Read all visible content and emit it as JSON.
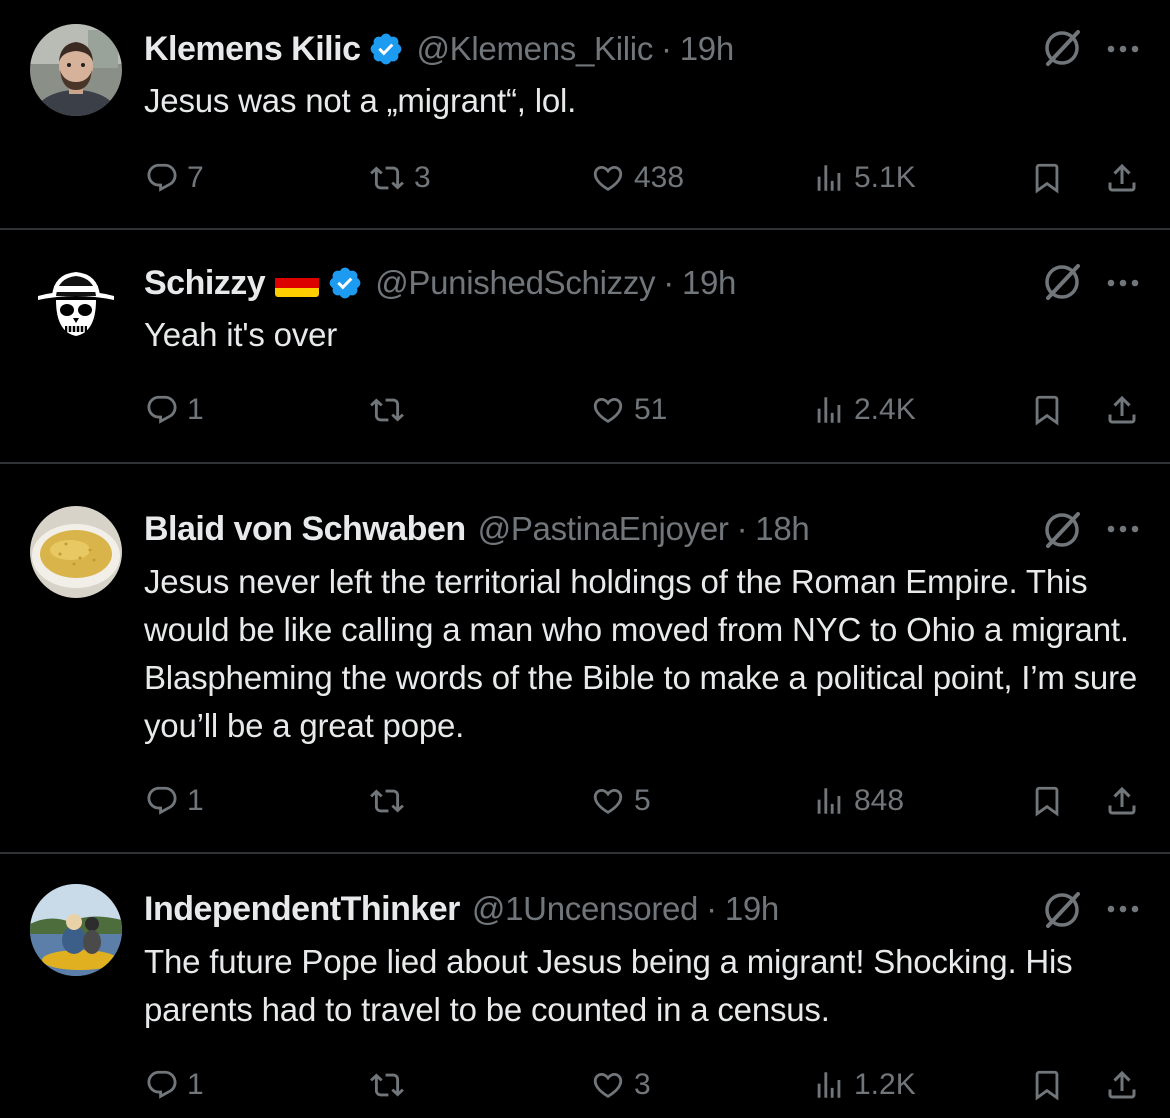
{
  "tweets": [
    {
      "name": "Klemens Kilic",
      "verified": true,
      "flag": null,
      "handle": "@Klemens_Kilic",
      "separator": "·",
      "time": "19h",
      "text": "Jesus was not a „migrant“, lol.",
      "replies": "7",
      "reposts": "3",
      "likes": "438",
      "views": "5.1K",
      "avatar_icon": "bearded-man-avatar"
    },
    {
      "name": "Schizzy",
      "verified": true,
      "flag": "germany-flag-emoji",
      "handle": "@PunishedSchizzy",
      "separator": "·",
      "time": "19h",
      "text": "Yeah it's over",
      "replies": "1",
      "reposts": "",
      "likes": "51",
      "views": "2.4K",
      "avatar_icon": "skull-bucket-hat-avatar"
    },
    {
      "name": "Blaid von Schwaben",
      "verified": false,
      "flag": null,
      "handle": "@PastinaEnjoyer",
      "separator": "·",
      "time": "18h",
      "text": "Jesus never left the territorial holdings of the Roman Empire. This would be like calling a man who moved from NYC to Ohio a migrant. Blaspheming the words of the Bible to make a political point, I’m sure you’ll be a great pope.",
      "replies": "1",
      "reposts": "",
      "likes": "5",
      "views": "848",
      "avatar_icon": "pastina-bowl-avatar"
    },
    {
      "name": "IndependentThinker",
      "verified": false,
      "flag": null,
      "handle": "@1Uncensored",
      "separator": "·",
      "time": "19h",
      "text": "The future Pope lied about Jesus being a migrant! Shocking. His parents had to travel to be counted in a census.",
      "replies": "1",
      "reposts": "",
      "likes": "3",
      "views": "1.2K",
      "avatar_icon": "kayak-photo-avatar"
    }
  ],
  "icons": {
    "reply": "reply-icon",
    "repost": "repost-icon",
    "like": "like-icon",
    "views": "views-icon",
    "bookmark": "bookmark-icon",
    "share": "share-icon",
    "grok": "grok-icon",
    "more": "more-icon",
    "verified": "verified-badge-icon"
  },
  "colors": {
    "background": "#000000",
    "text_primary": "#e7e9ea",
    "text_secondary": "#71767b",
    "divider": "#2f3336",
    "verified": "#1d9bf0",
    "flag_black": "#000000",
    "flag_red": "#dd0000",
    "flag_gold": "#ffce00"
  }
}
